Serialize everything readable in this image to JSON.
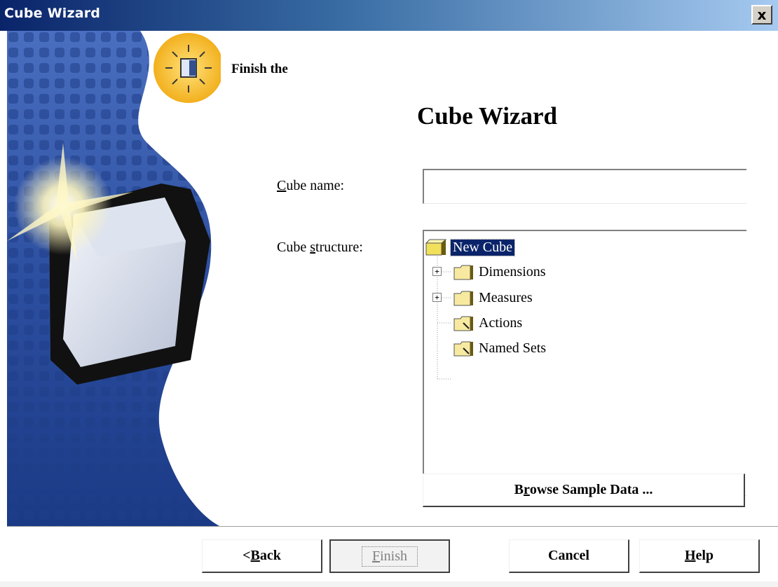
{
  "window": {
    "title": "Cube Wizard",
    "close_label": "x"
  },
  "header": {
    "subtitle": "Finish the",
    "title": "Cube Wizard"
  },
  "form": {
    "cube_name_prefix": "C",
    "cube_name_rest": "ube name:",
    "cube_name_value": "",
    "cube_structure_prefix": "Cube ",
    "cube_structure_underlined": "s",
    "cube_structure_rest": "tructure:"
  },
  "tree": {
    "root": "New Cube",
    "items": [
      {
        "label": "Dimensions",
        "expandable": true,
        "icon": "folder-icon"
      },
      {
        "label": "Measures",
        "expandable": true,
        "icon": "folder-icon"
      },
      {
        "label": "Actions",
        "expandable": false,
        "icon": "folder-icon"
      },
      {
        "label": "Named Sets",
        "expandable": false,
        "icon": "folder-icon"
      }
    ]
  },
  "buttons": {
    "browse_prefix": "B",
    "browse_underlined": "r",
    "browse_rest": "owse Sample Data ...",
    "back_prefix": "< ",
    "back_underlined": "B",
    "back_rest": "ack",
    "finish_underlined": "F",
    "finish_rest": "inish",
    "cancel": "Cancel",
    "help_underlined": "H",
    "help_rest": "elp"
  },
  "colors": {
    "titlebar_start": "#0a246a",
    "selection": "#0a246a",
    "panel_blue": "#2b4f9e",
    "folder_yellow": "#f5e79a"
  }
}
